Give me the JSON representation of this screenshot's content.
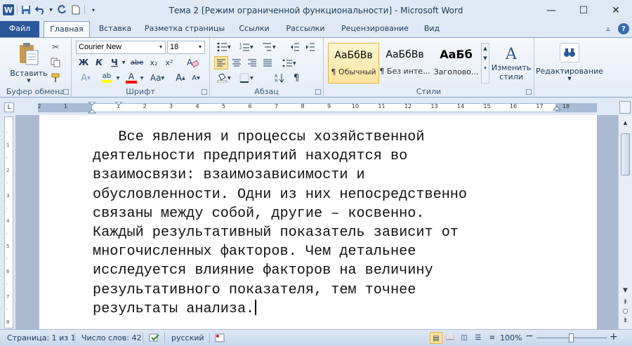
{
  "window": {
    "title": "Тема 2 [Режим ограниченной функциональности]  -  Microsoft Word",
    "app_icon": "W",
    "minimize": "—",
    "maximize": "☐",
    "close": "✕"
  },
  "qat": {
    "save_icon": "save-icon",
    "undo_icon": "undo-icon",
    "redo_icon": "redo-icon",
    "new_icon": "new-document-icon",
    "customize_icon": "customize-qat-icon"
  },
  "tabs": [
    {
      "label": "Файл"
    },
    {
      "label": "Главная"
    },
    {
      "label": "Вставка"
    },
    {
      "label": "Разметка страницы"
    },
    {
      "label": "Ссылки"
    },
    {
      "label": "Рассылки"
    },
    {
      "label": "Рецензирование"
    },
    {
      "label": "Вид"
    }
  ],
  "ribbon": {
    "clipboard": {
      "paste_label": "Вставить",
      "group_label": "Буфер обмена"
    },
    "font": {
      "font_name": "Courier New",
      "font_size": "18",
      "bold": "Ж",
      "italic": "К",
      "underline": "Ч",
      "strike": "abe",
      "subscript": "x₂",
      "superscript": "x²",
      "grow": "A",
      "shrink": "A",
      "case": "Aa",
      "font_color": "A",
      "highlight": "ab",
      "group_label": "Шрифт"
    },
    "paragraph": {
      "group_label": "Абзац",
      "pilcrow": "¶"
    },
    "styles": {
      "items": [
        {
          "sample": "АаБбВв",
          "name": "¶ Обычный"
        },
        {
          "sample": "АаБбВв",
          "name": "¶ Без инте..."
        },
        {
          "sample": "АаБб",
          "name": "Заголово..."
        }
      ],
      "change_label_1": "Изменить",
      "change_label_2": "стили",
      "group_label": "Стили"
    },
    "editing": {
      "label": "Редактирование"
    }
  },
  "ruler": {
    "numbers": [
      "2",
      "1",
      "1",
      "2",
      "3",
      "4",
      "5",
      "6",
      "7",
      "8",
      "9",
      "10",
      "11",
      "12",
      "13",
      "14",
      "15",
      "16",
      "17",
      "18"
    ]
  },
  "document": {
    "lines": [
      "   Все явления и процессы хозяйственной",
      "деятельности предприятий находятся во",
      "взаимосвязи: взаимозависимости и",
      "обусловленности. Одни из них непосредственно",
      "связаны между собой, другие – косвенно.",
      "Каждый результативный показатель зависит от",
      "многочисленных факторов. Чем детальнее",
      "исследуется влияние факторов на величину",
      "результативного показателя, тем точнее",
      "результаты анализа."
    ]
  },
  "statusbar": {
    "page": "Страница: 1 из 1",
    "words": "Число слов: 42",
    "language": "русский",
    "zoom": "100%",
    "zoom_minus": "−",
    "zoom_plus": "+"
  },
  "colors": {
    "accent": "#2b579a",
    "ribbon_bg": "#f5f8fc",
    "highlight_yellow": "#ffff00",
    "font_color_red": "#ff0000"
  }
}
